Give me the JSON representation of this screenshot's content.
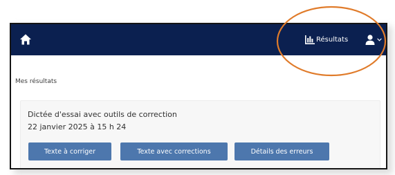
{
  "header": {
    "home_icon": "home-icon",
    "results_label": "Résultats",
    "results_icon": "bar-chart-icon",
    "user_icon": "user-icon",
    "chevron_icon": "chevron-down-icon",
    "background_color": "#0b2050"
  },
  "main": {
    "page_title": "Mes résultats",
    "card": {
      "title": "Dictée d'essai avec outils de correction",
      "date": "22 janvier 2025 à 15 h 24",
      "buttons": [
        {
          "label": "Texte à corriger"
        },
        {
          "label": "Texte avec corrections"
        },
        {
          "label": "Détails des erreurs"
        }
      ],
      "button_color": "#4d77ad"
    }
  },
  "annotation": {
    "shape": "ellipse",
    "color": "#e07b2a"
  }
}
